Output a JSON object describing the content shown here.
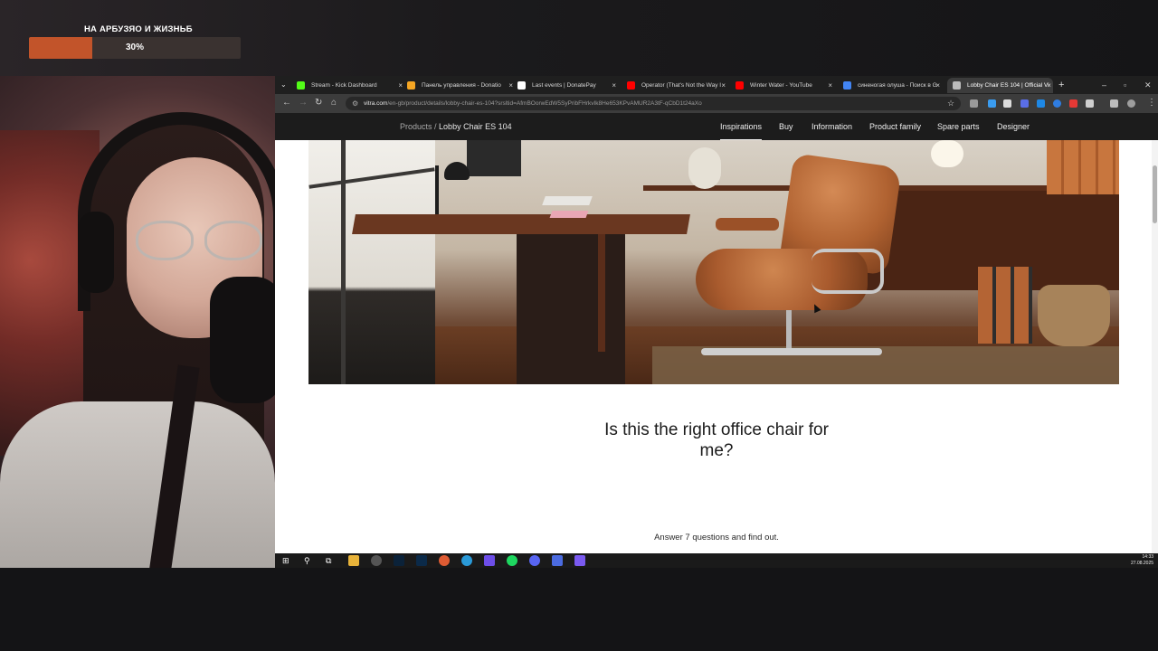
{
  "stream_overlay": {
    "goal_title": "НА АРБУЗЯО И ЖИЗНЬБ",
    "goal_percent_label": "30%",
    "goal_progress": 0.3,
    "accent_color": "#c2542a"
  },
  "browser": {
    "tabs": [
      {
        "label": "Stream - Kick Dashboard",
        "favicon_color": "#53fc18"
      },
      {
        "label": "Панель управления - Donatio",
        "favicon_color": "#f5a623"
      },
      {
        "label": "Last events | DonatePay",
        "favicon_color": "#ffffff"
      },
      {
        "label": "Operator (That's Not the Way I",
        "favicon_color": "#ff0000"
      },
      {
        "label": "Winter Water - YouTube",
        "favicon_color": "#ff0000"
      },
      {
        "label": "синеногая олуша - Поиск в G",
        "favicon_color": "#4285f4"
      },
      {
        "label": "Lobby Chair ES 104 | Official Vi",
        "favicon_color": "#bbbbbb",
        "active": true
      }
    ],
    "address": {
      "domain": "vitra.com",
      "path": "/en-gb/product/details/lobby-chair-es-104?srsltid=AfmBOorwEdW5SyPribFHrkvIk8He653KPvAMUR2A3tF-qCbD1t24aXo"
    }
  },
  "site": {
    "breadcrumb_parent": "Products /",
    "breadcrumb_current": "Lobby Chair ES 104",
    "nav": [
      "Inspirations",
      "Buy",
      "Information",
      "Product family",
      "Spare parts",
      "Designer"
    ],
    "active_nav": "Inspirations",
    "question": "Is this the right office chair for me?",
    "subtitle": "Answer 7 questions and find out."
  },
  "taskbar": {
    "time": "14:33",
    "date": "27.08.2025"
  }
}
